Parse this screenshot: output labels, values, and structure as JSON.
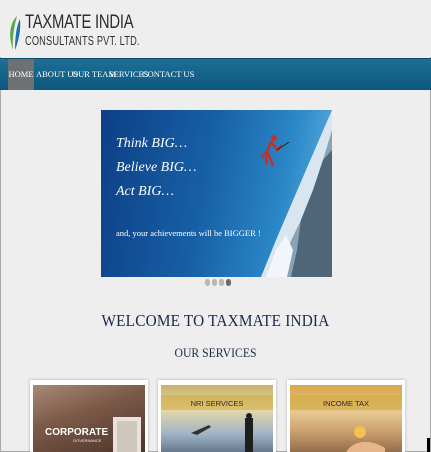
{
  "brand": {
    "name_line1": "TAXMATE INDIA",
    "name_line2": "CONSULTANTS PVT. LTD.",
    "colors": {
      "leaf_green": "#5aa845",
      "leaf_blue": "#1d6fb5"
    }
  },
  "nav": {
    "background": "#0b587e",
    "items": [
      {
        "label": "HOME",
        "active": true
      },
      {
        "label": "ABOUT US",
        "active": false
      },
      {
        "label": "OUR TEAM",
        "active": false
      },
      {
        "label": "SERVICES",
        "active": false
      },
      {
        "label": "CONTACT US",
        "active": false
      }
    ]
  },
  "banner": {
    "lines": [
      "Think BIG…",
      "Believe BIG…",
      "Act BIG…"
    ],
    "subline": "and, your achievements will be BIGGER !"
  },
  "slider": {
    "slide_count": 4,
    "active_index": 3
  },
  "welcome": {
    "title": "WELCOME TO TAXMATE INDIA"
  },
  "services": {
    "heading": "OUR SERVICES",
    "cards": [
      {
        "title": "CORPORATE",
        "subtitle": "GOVERNANCE"
      },
      {
        "title": "NRI SERVICES"
      },
      {
        "title": "INCOME TAX"
      }
    ]
  }
}
